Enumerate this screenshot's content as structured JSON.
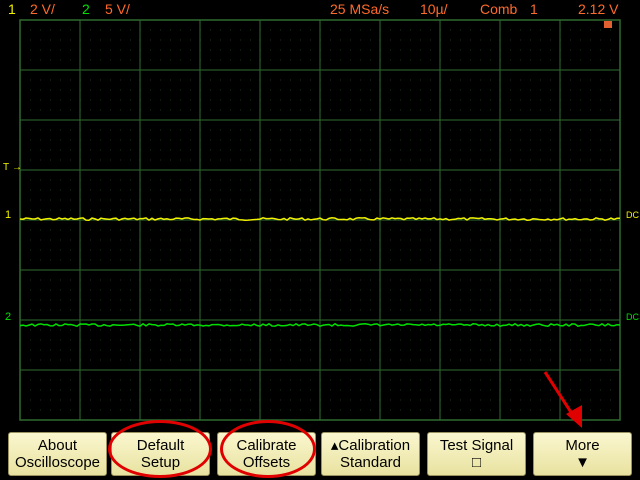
{
  "status": {
    "ch1_num": "1",
    "ch1_scale": "2 V/",
    "ch2_num": "2",
    "ch2_scale": "5 V/",
    "sample_rate": "25 MSa/s",
    "timebase": "10µ/",
    "trigger_mode": "Comb",
    "trigger_source": "⁢1",
    "trigger_level": "2.12 V"
  },
  "markers": {
    "trigger": "T",
    "ch1": "1",
    "ch2": "2",
    "ch1_coupling": "DC",
    "ch2_coupling": "DC"
  },
  "softkeys": [
    {
      "line1": "About",
      "line2": "Oscilloscope"
    },
    {
      "line1": "Default",
      "line2": "Setup"
    },
    {
      "line1": "Calibrate",
      "line2": "Offsets"
    },
    {
      "line1": "▴Calibration",
      "line2": "Standard"
    },
    {
      "line1": "Test Signal",
      "line2": "□"
    },
    {
      "line1": "More",
      "line2": "▼"
    }
  ],
  "colors": {
    "ch1": "#f2f200",
    "ch2": "#00e000",
    "grid": "#2f6b2f",
    "annotation": "#e00000"
  }
}
